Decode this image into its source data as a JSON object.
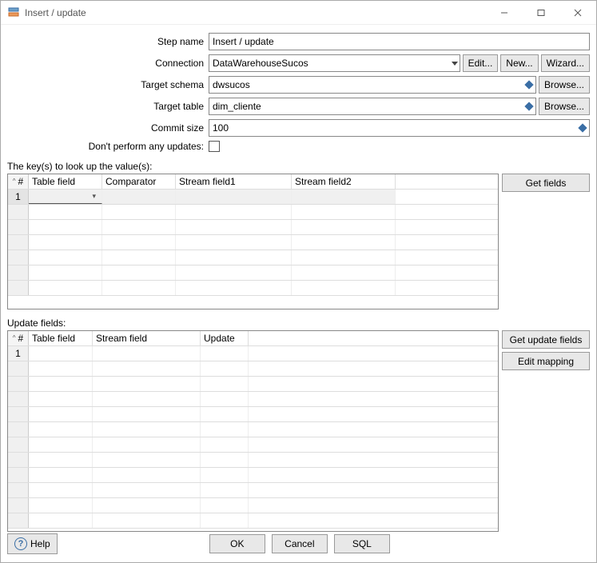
{
  "window": {
    "title": "Insert / update"
  },
  "form": {
    "step_name_label": "Step name",
    "step_name_value": "Insert / update",
    "connection_label": "Connection",
    "connection_value": "DataWarehouseSucos",
    "connection_edit_btn": "Edit...",
    "connection_new_btn": "New...",
    "connection_wizard_btn": "Wizard...",
    "target_schema_label": "Target schema",
    "target_schema_value": "dwsucos",
    "target_schema_browse_btn": "Browse...",
    "target_table_label": "Target table",
    "target_table_value": "dim_cliente",
    "target_table_browse_btn": "Browse...",
    "commit_size_label": "Commit size",
    "commit_size_value": "100",
    "dont_update_label": "Don't perform any updates:"
  },
  "keys_section": {
    "label": "The key(s) to look up the value(s):",
    "columns": {
      "rownum": "#",
      "table_field": "Table field",
      "comparator": "Comparator",
      "stream_field1": "Stream field1",
      "stream_field2": "Stream field2"
    },
    "rows": [
      {
        "num": "1"
      }
    ],
    "get_fields_btn": "Get fields"
  },
  "update_section": {
    "label": "Update fields:",
    "columns": {
      "rownum": "#",
      "table_field": "Table field",
      "stream_field": "Stream field",
      "update": "Update"
    },
    "rows": [
      {
        "num": "1"
      }
    ],
    "get_update_fields_btn": "Get update fields",
    "edit_mapping_btn": "Edit mapping"
  },
  "bottom": {
    "help": "Help",
    "ok": "OK",
    "cancel": "Cancel",
    "sql": "SQL"
  }
}
